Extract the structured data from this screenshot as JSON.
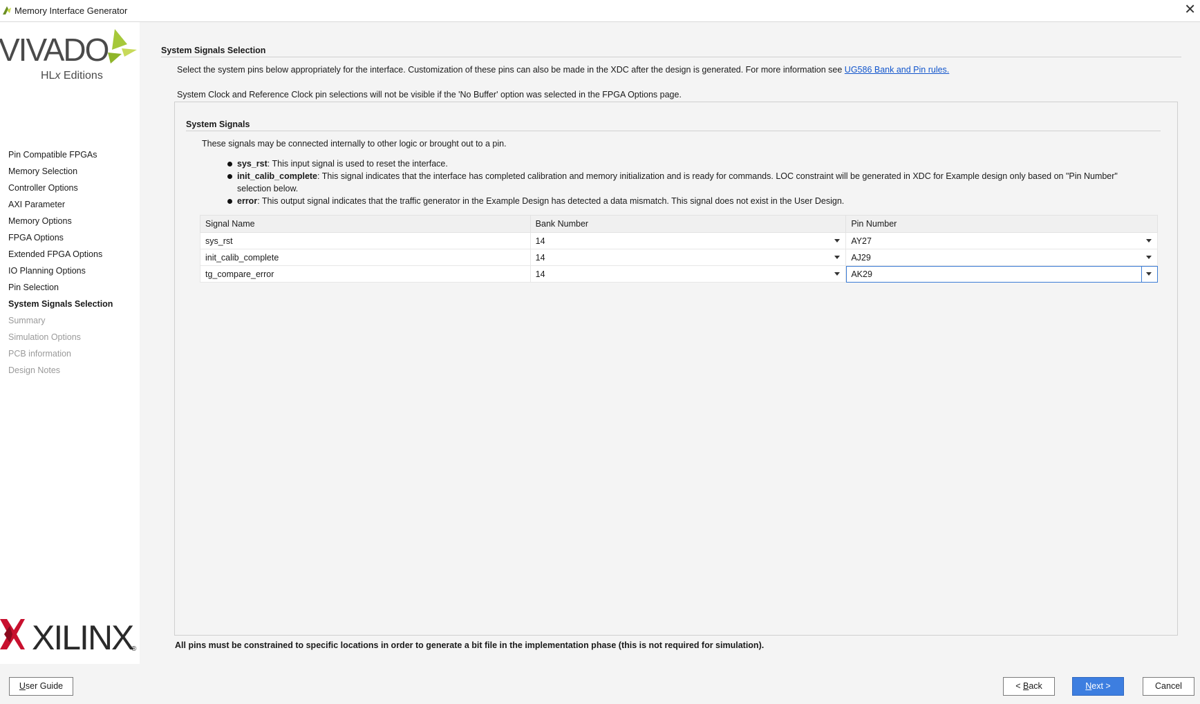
{
  "window": {
    "title": "Memory Interface Generator"
  },
  "branding": {
    "vivado": "VIVADO",
    "vivado_edition_prefix": "HL",
    "vivado_edition_x": "x",
    "vivado_edition_suffix": " Editions",
    "xilinx": "XILINX",
    "registered": "®"
  },
  "nav": {
    "items": [
      {
        "label": "Pin Compatible FPGAs",
        "state": "normal"
      },
      {
        "label": "Memory Selection",
        "state": "normal"
      },
      {
        "label": "Controller Options",
        "state": "normal"
      },
      {
        "label": "AXI Parameter",
        "state": "normal"
      },
      {
        "label": "Memory Options",
        "state": "normal"
      },
      {
        "label": "FPGA Options",
        "state": "normal"
      },
      {
        "label": "Extended FPGA Options",
        "state": "normal"
      },
      {
        "label": "IO Planning Options",
        "state": "normal"
      },
      {
        "label": "Pin Selection",
        "state": "normal"
      },
      {
        "label": "System Signals Selection",
        "state": "active"
      },
      {
        "label": "Summary",
        "state": "disabled"
      },
      {
        "label": "Simulation Options",
        "state": "disabled"
      },
      {
        "label": "PCB information",
        "state": "disabled"
      },
      {
        "label": "Design Notes",
        "state": "disabled"
      }
    ]
  },
  "page": {
    "section_title": "System Signals Selection",
    "intro_text": "Select the system pins below appropriately for the interface. Customization of these pins can also be made in the XDC after the design is generated. For more information see ",
    "intro_link": "UG586 Bank and Pin rules.",
    "clock_note": "System Clock and Reference Clock pin selections will not be visible if the 'No Buffer' option was selected in the FPGA Options page.",
    "panel": {
      "title": "System Signals",
      "description": "These signals may be connected internally to other logic or brought out to a pin.",
      "bullets": [
        {
          "term": "sys_rst",
          "text": ": This input signal is used to reset the interface."
        },
        {
          "term": "init_calib_complete",
          "text": ": This signal indicates that the interface has completed calibration and memory initialization and is ready for commands. LOC constraint will be generated in XDC for Example design only based on \"Pin Number\" selection below."
        },
        {
          "term": "error",
          "text": ": This output signal indicates that the traffic generator in the Example Design has detected a data mismatch. This signal does not exist in the User Design."
        }
      ]
    },
    "table": {
      "headers": [
        "Signal Name",
        "Bank Number",
        "Pin Number"
      ],
      "rows": [
        {
          "signal": "sys_rst",
          "bank": "14",
          "pin": "AY27"
        },
        {
          "signal": "init_calib_complete",
          "bank": "14",
          "pin": "AJ29"
        },
        {
          "signal": "tg_compare_error",
          "bank": "14",
          "pin": "AK29"
        }
      ]
    },
    "footer_note": "All pins must be constrained to specific locations in order to generate a bit file in the implementation phase (this is not required for simulation)."
  },
  "buttons": {
    "user_guide": {
      "mnemonic": "U",
      "rest": "ser Guide"
    },
    "back": {
      "prefix": "< ",
      "mnemonic": "B",
      "rest": "ack"
    },
    "next": {
      "mnemonic": "N",
      "rest": "ext >"
    },
    "cancel": "Cancel"
  },
  "colors": {
    "primary_button": "#3d7ee0",
    "link": "#1155cc",
    "vivado_leaf": "#a6c83a",
    "xilinx_red": "#c8102e"
  }
}
